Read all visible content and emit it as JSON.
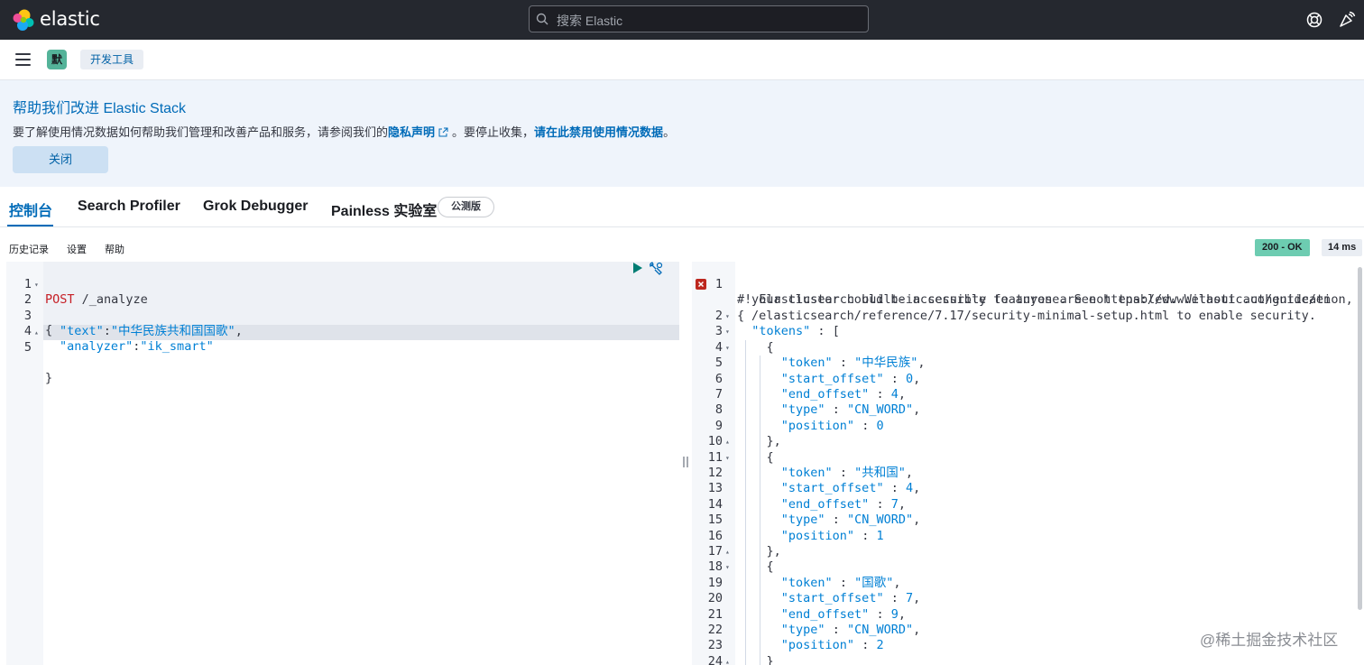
{
  "header": {
    "brand": "elastic",
    "search_placeholder": "搜索 Elastic",
    "icons": [
      "elastic-logo-icon",
      "search-icon",
      "help-icon",
      "newsfeed-icon"
    ]
  },
  "subbar": {
    "space_badge": "默",
    "breadcrumb": "开发工具"
  },
  "notice": {
    "title": "帮助我们改进 Elastic Stack",
    "body_prefix": "要了解使用情况数据如何帮助我们管理和改善产品和服务，请参阅我们的",
    "privacy_link": "隐私声明",
    "body_middle": "。要停止收集，",
    "disable_link": "请在此禁用使用情况数据",
    "body_suffix": "。",
    "close_label": "关闭"
  },
  "tabs": [
    {
      "label": "控制台",
      "active": true
    },
    {
      "label": "Search Profiler",
      "active": false
    },
    {
      "label": "Grok Debugger",
      "active": false
    },
    {
      "label": "Painless 实验室",
      "active": false
    }
  ],
  "beta_badge": "公测版",
  "menu": {
    "history": "历史记录",
    "settings": "设置",
    "help": "帮助"
  },
  "response_status": "200 - OK",
  "response_time": "14 ms",
  "request": {
    "lines": [
      {
        "n": "1",
        "method": "POST",
        "rest": " /_analyze"
      },
      {
        "n": "2",
        "text": "{"
      },
      {
        "n": "3",
        "key": "\"text\"",
        "sep": ":",
        "value": "\"中华民族共和国国歌\"",
        "tail": ","
      },
      {
        "n": "4",
        "key": "\"analyzer\"",
        "sep": ":",
        "value": "\"ik_smart\"",
        "tail": ""
      },
      {
        "n": "5",
        "text": "}"
      }
    ]
  },
  "response": {
    "warning_lines": [
      "#! Elasticsearch built-in security features are not enabled. Without authentication,",
      "your cluster could be accessible to anyone. See https://www.elastic.co/guide/en",
      "/elasticsearch/reference/7.17/security-minimal-setup.html to enable security."
    ],
    "lines": [
      {
        "n": "2",
        "text": "{"
      },
      {
        "n": "3",
        "text": "  \"tokens\" : ["
      },
      {
        "n": "4",
        "text": "    {"
      },
      {
        "n": "5",
        "text": "      \"token\" : \"中华民族\","
      },
      {
        "n": "6",
        "text": "      \"start_offset\" : 0,"
      },
      {
        "n": "7",
        "text": "      \"end_offset\" : 4,"
      },
      {
        "n": "8",
        "text": "      \"type\" : \"CN_WORD\","
      },
      {
        "n": "9",
        "text": "      \"position\" : 0"
      },
      {
        "n": "10",
        "text": "    },"
      },
      {
        "n": "11",
        "text": "    {"
      },
      {
        "n": "12",
        "text": "      \"token\" : \"共和国\","
      },
      {
        "n": "13",
        "text": "      \"start_offset\" : 4,"
      },
      {
        "n": "14",
        "text": "      \"end_offset\" : 7,"
      },
      {
        "n": "15",
        "text": "      \"type\" : \"CN_WORD\","
      },
      {
        "n": "16",
        "text": "      \"position\" : 1"
      },
      {
        "n": "17",
        "text": "    },"
      },
      {
        "n": "18",
        "text": "    {"
      },
      {
        "n": "19",
        "text": "      \"token\" : \"国歌\","
      },
      {
        "n": "20",
        "text": "      \"start_offset\" : 7,"
      },
      {
        "n": "21",
        "text": "      \"end_offset\" : 9,"
      },
      {
        "n": "22",
        "text": "      \"type\" : \"CN_WORD\","
      },
      {
        "n": "23",
        "text": "      \"position\" : 2"
      },
      {
        "n": "24",
        "text": "    }"
      }
    ]
  },
  "watermark": "@稀土掘金技术社区"
}
